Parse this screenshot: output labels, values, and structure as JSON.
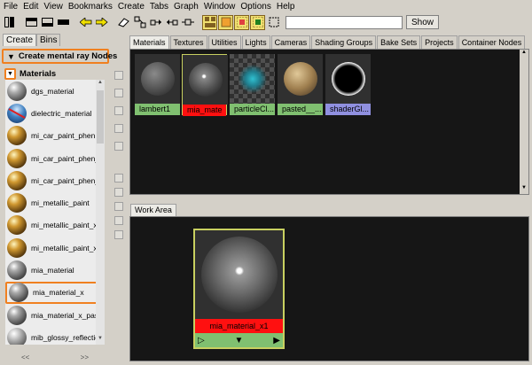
{
  "menu": [
    "File",
    "Edit",
    "View",
    "Bookmarks",
    "Create",
    "Tabs",
    "Graph",
    "Window",
    "Options",
    "Help"
  ],
  "toolbar": {
    "show_label": "Show",
    "search_value": ""
  },
  "left": {
    "tabs": [
      "Create",
      "Bins"
    ],
    "create_header": "Create mental ray Nodes",
    "materials_header": "Materials",
    "items": [
      {
        "label": "dgs_material",
        "swatch": "grey"
      },
      {
        "label": "dielectric_material",
        "swatch": "dielectric"
      },
      {
        "label": "mi_car_paint_phen",
        "swatch": "gold"
      },
      {
        "label": "mi_car_paint_phen_",
        "swatch": "gold"
      },
      {
        "label": "mi_car_paint_phen_",
        "swatch": "gold"
      },
      {
        "label": "mi_metallic_paint",
        "swatch": "gold"
      },
      {
        "label": "mi_metallic_paint_x",
        "swatch": "gold"
      },
      {
        "label": "mi_metallic_paint_x",
        "swatch": "gold"
      },
      {
        "label": "mia_material",
        "swatch": "silver"
      },
      {
        "label": "mia_material_x",
        "swatch": "silver"
      },
      {
        "label": "mia_material_x_pass",
        "swatch": "silver"
      },
      {
        "label": "mib_glossy_reflectio",
        "swatch": "silver"
      }
    ],
    "scroll_left": "<<",
    "scroll_right": ">>"
  },
  "top_tabs": [
    "Materials",
    "Textures",
    "Utilities",
    "Lights",
    "Cameras",
    "Shading Groups",
    "Bake Sets",
    "Projects",
    "Container Nodes"
  ],
  "swatches": [
    {
      "label": "lambert1",
      "label_color": "#80c070",
      "ball": "lambert",
      "selected": false
    },
    {
      "label": "mia_mate",
      "label_color": "#ff1010",
      "ball": "mia",
      "selected": true
    },
    {
      "label": "particleCl...",
      "label_color": "#80c070",
      "ball": "particle",
      "selected": false
    },
    {
      "label": "pasted__...",
      "label_color": "#80c070",
      "ball": "pasted",
      "selected": false
    },
    {
      "label": "shaderGl...",
      "label_color": "#9090e0",
      "ball": "glow",
      "selected": false
    }
  ],
  "work_area": {
    "tab": "Work Area",
    "node_label": "mia_material_x1",
    "node_label_color": "#ff1010"
  },
  "colors": {
    "highlight": "#f08020",
    "node_border": "#c8d060",
    "green": "#80c070"
  }
}
